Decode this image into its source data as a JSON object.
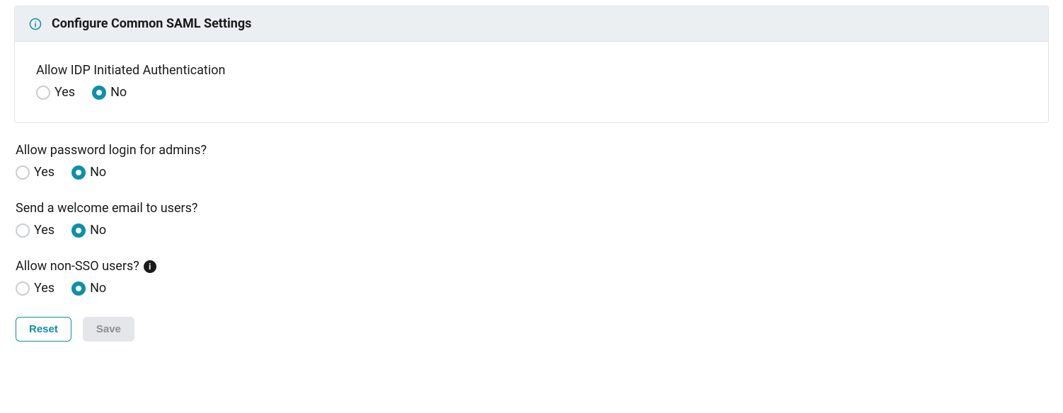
{
  "panel": {
    "title": "Configure Common SAML Settings"
  },
  "fields": {
    "idp_auth": {
      "label": "Allow IDP Initiated Authentication",
      "yes": "Yes",
      "no": "No",
      "selected": "no"
    },
    "admin_password": {
      "label": "Allow password login for admins?",
      "yes": "Yes",
      "no": "No",
      "selected": "no"
    },
    "welcome_email": {
      "label": "Send a welcome email to users?",
      "yes": "Yes",
      "no": "No",
      "selected": "no"
    },
    "non_sso": {
      "label": "Allow non-SSO users?",
      "yes": "Yes",
      "no": "No",
      "selected": "no"
    }
  },
  "buttons": {
    "reset": "Reset",
    "save": "Save"
  },
  "help_icon_text": "i"
}
